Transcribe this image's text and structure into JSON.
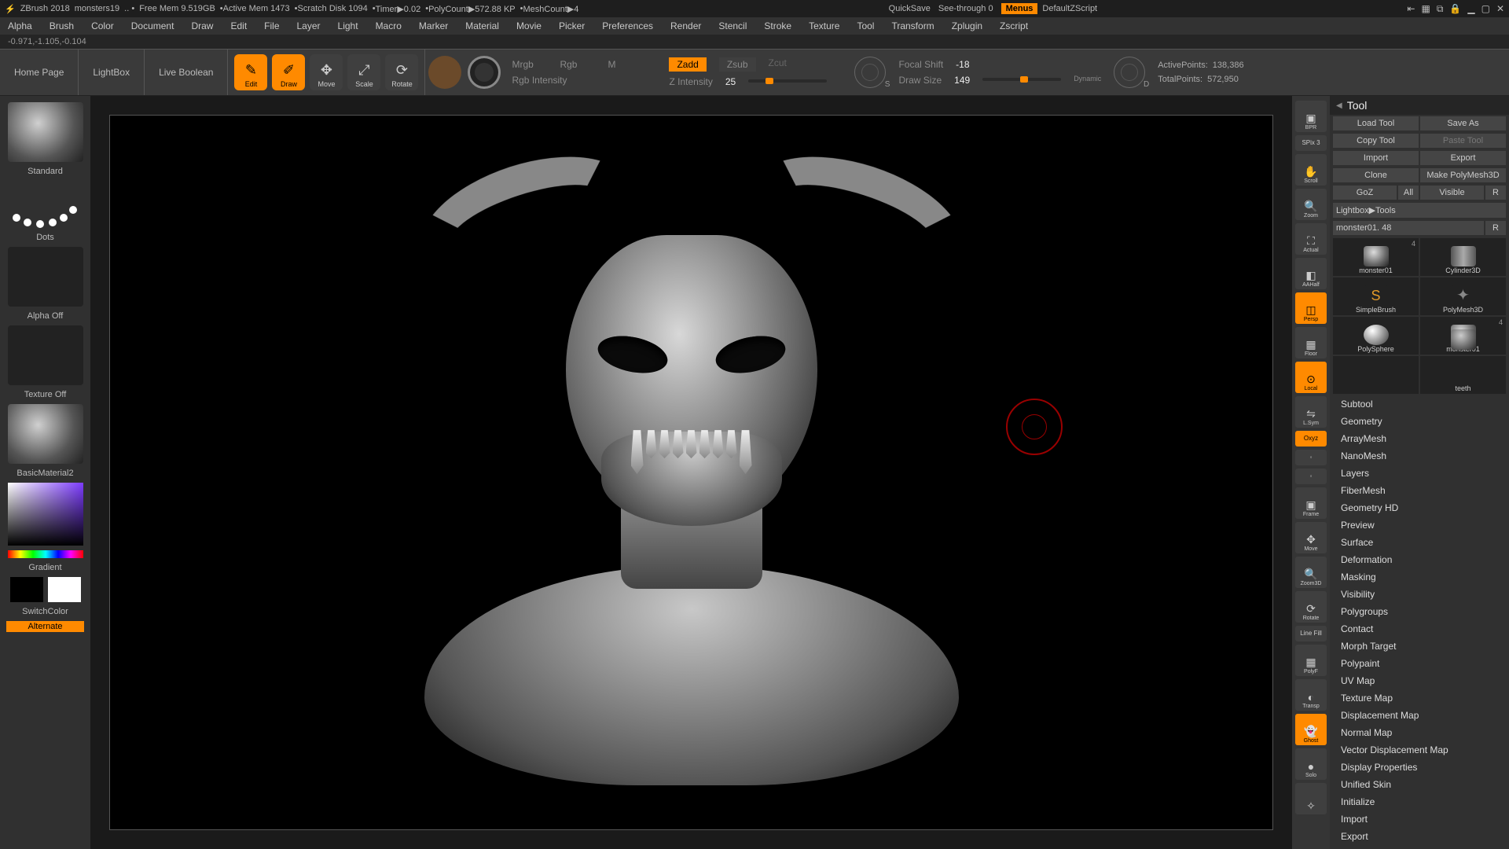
{
  "titlebar": {
    "app": "ZBrush 2018",
    "doc": "monsters19",
    "freemem": "Free Mem 9.519GB",
    "activemem": "Active Mem 1473",
    "scratch": "Scratch Disk 1094",
    "timer": "Timer▶0.02",
    "polycount": "PolyCount▶572.88 KP",
    "meshcount": "MeshCount▶4",
    "quicksave": "QuickSave",
    "seethrough": "See-through  0",
    "menus": "Menus",
    "zscript": "DefaultZScript"
  },
  "menus": [
    "Alpha",
    "Brush",
    "Color",
    "Document",
    "Draw",
    "Edit",
    "File",
    "Layer",
    "Light",
    "Macro",
    "Marker",
    "Material",
    "Movie",
    "Picker",
    "Preferences",
    "Render",
    "Stencil",
    "Stroke",
    "Texture",
    "Tool",
    "Transform",
    "Zplugin",
    "Zscript"
  ],
  "status": "-0.971,-1.105,-0.104",
  "shelf": {
    "home": "Home Page",
    "lightbox": "LightBox",
    "liveboolean": "Live Boolean",
    "modes": [
      "Edit",
      "Draw",
      "Move",
      "Scale",
      "Rotate"
    ],
    "mrgb": "Mrgb",
    "rgb": "Rgb",
    "m": "M",
    "rgbint": "Rgb Intensity",
    "zadd": "Zadd",
    "zsub": "Zsub",
    "zcut": "Zcut",
    "zint": "Z Intensity",
    "zintval": "25",
    "focal": "Focal Shift",
    "focalval": "-18",
    "drawsize": "Draw Size",
    "drawsizeval": "149",
    "dynamic": "Dynamic",
    "active": "ActivePoints:",
    "activeval": "138,386",
    "total": "TotalPoints:",
    "totalval": "572,950"
  },
  "left": {
    "brush": "Standard",
    "stroke": "Dots",
    "alpha": "Alpha Off",
    "texture": "Texture Off",
    "material": "BasicMaterial2",
    "gradient": "Gradient",
    "switch": "SwitchColor",
    "alternate": "Alternate"
  },
  "rshelf": [
    "BPR",
    "SPix 3",
    "Scroll",
    "Zoom",
    "Actual",
    "AAHalf",
    "Persp",
    "Floor",
    "Local",
    "L.Sym",
    "Oxyz",
    "",
    "",
    "Frame",
    "Move",
    "Zoom3D",
    "Rotate",
    "Line Fill",
    "PolyF",
    "Transp",
    "Ghost",
    "Solo",
    ""
  ],
  "tool": {
    "title": "Tool",
    "rows": [
      [
        "Load Tool",
        "Save As"
      ],
      [
        "Copy Tool",
        "Paste Tool"
      ],
      [
        "Import",
        "Export"
      ],
      [
        "Clone",
        "Make PolyMesh3D"
      ],
      [
        "GoZ",
        "All",
        "Visible",
        "R"
      ]
    ],
    "lightbox": "Lightbox▶Tools",
    "current": "monster01.",
    "currentnum": "48",
    "tools": [
      {
        "name": "monster01",
        "badge": "4"
      },
      {
        "name": "Cylinder3D",
        "badge": ""
      },
      {
        "name": "SimpleBrush",
        "badge": ""
      },
      {
        "name": "PolyMesh3D",
        "badge": ""
      },
      {
        "name": "PolySphere",
        "badge": ""
      },
      {
        "name": "monster01",
        "badge": "4"
      },
      {
        "name": "",
        "badge": ""
      },
      {
        "name": "teeth",
        "badge": ""
      }
    ],
    "subs": [
      "Subtool",
      "Geometry",
      "ArrayMesh",
      "NanoMesh",
      "Layers",
      "FiberMesh",
      "Geometry HD",
      "Preview",
      "Surface",
      "Deformation",
      "Masking",
      "Visibility",
      "Polygroups",
      "Contact",
      "Morph Target",
      "Polypaint",
      "UV Map",
      "Texture Map",
      "Displacement Map",
      "Normal Map",
      "Vector Displacement Map",
      "Display Properties",
      "Unified Skin",
      "Initialize",
      "Import",
      "Export"
    ]
  }
}
